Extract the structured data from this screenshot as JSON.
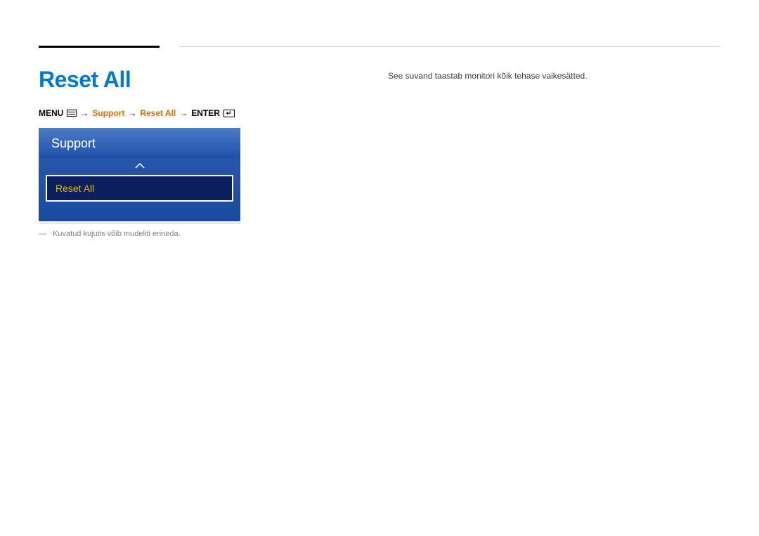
{
  "title": "Reset All",
  "breadcrumb": {
    "menu": "MENU",
    "support": "Support",
    "resetall": "Reset All",
    "enter": "ENTER",
    "arrow": "→"
  },
  "menubox": {
    "header": "Support",
    "item": "Reset All"
  },
  "caption": "Kuvatud kujutis võib mudeliti erineda.",
  "description": "See suvand taastab monitori kõik tehase vaikesätted."
}
